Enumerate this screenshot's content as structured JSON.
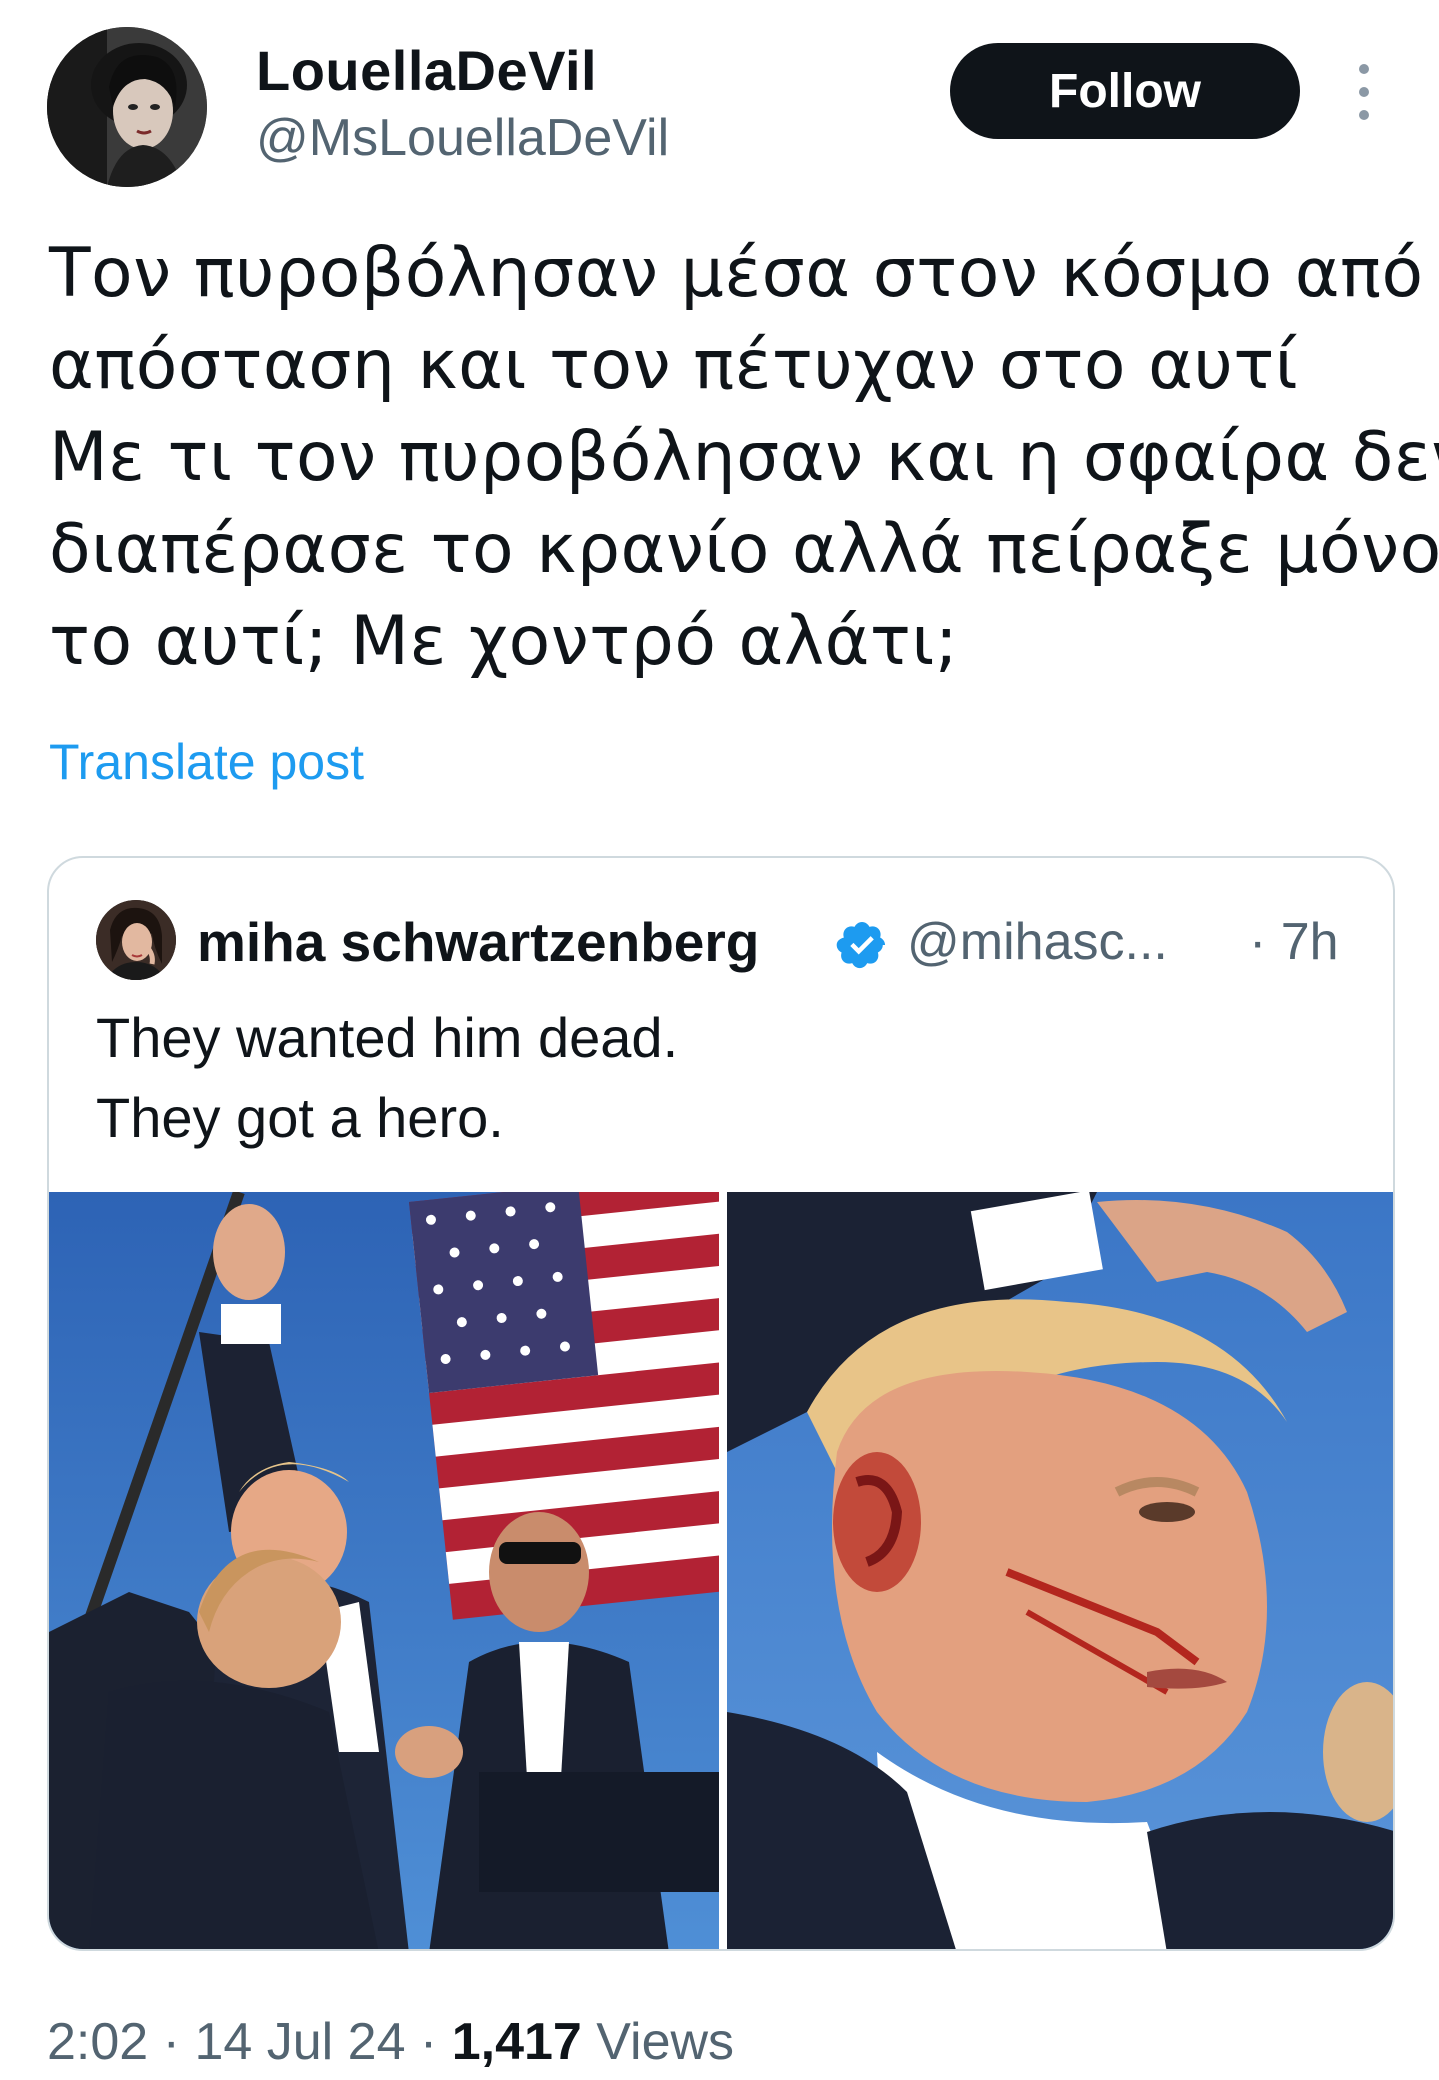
{
  "author": {
    "display_name": "LouellaDeVil",
    "handle": "@MsLouellaDeVil",
    "avatar_icon": "profile-photo"
  },
  "actions": {
    "follow_label": "Follow",
    "more_icon": "more-vertical-icon"
  },
  "post": {
    "lines": [
      "Τον πυροβόλησαν μέσα στον κόσμο από",
      "απόσταση και τον πέτυχαν στο αυτί",
      "Με τι τον πυροβόλησαν και η σφαίρα δεν",
      "διαπέρασε το κρανίο αλλά πείραξε μόνο",
      "το αυτί; Με χοντρό αλάτι;"
    ],
    "translate_label": "Translate post"
  },
  "quoted": {
    "display_name": "miha schwartzenberg",
    "verified_icon": "verified-badge-icon",
    "handle": "@mihasc...",
    "time": "· 7h",
    "lines": [
      "They wanted him dead.",
      "They got a hero."
    ],
    "media_count": 2
  },
  "meta": {
    "time": "2:02",
    "sep1": " · ",
    "date": "14 Jul 24",
    "sep2": " · ",
    "views_count": "1,417",
    "views_label": " Views"
  },
  "colors": {
    "text": "#0f1419",
    "secondary": "#536471",
    "link": "#1d9bf0",
    "follow_bg": "#0f1419",
    "border": "#cfd9de",
    "verified": "#1d9bf0"
  }
}
